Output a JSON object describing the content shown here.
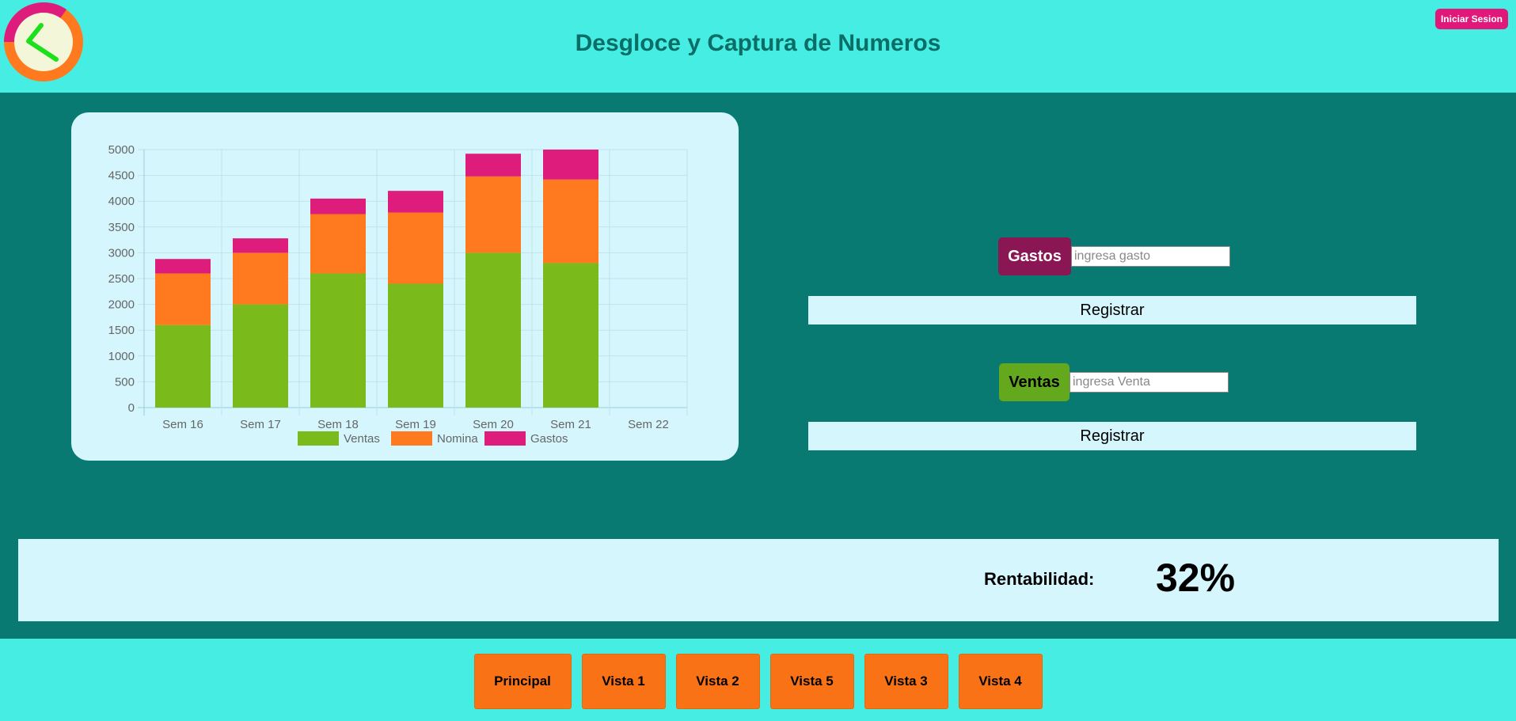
{
  "header": {
    "title": "Desgloce y Captura de Numeros",
    "login_label": "Iniciar Sesion",
    "logo_icon": "clock-logo-icon"
  },
  "colors": {
    "header_bg": "#45ede2",
    "main_bg": "#087a72",
    "card_bg": "#d5f6fd",
    "ventas": "#7aba1a",
    "nomina": "#ff7a1e",
    "gastos": "#de1c7c",
    "nav_button": "#f97316",
    "login_button": "#e0187a"
  },
  "chart_data": {
    "type": "bar",
    "stacked": true,
    "categories": [
      "Sem 16",
      "Sem 17",
      "Sem 18",
      "Sem 19",
      "Sem 20",
      "Sem 21",
      "Sem 22"
    ],
    "series": [
      {
        "name": "Ventas",
        "color": "#7aba1a",
        "values": [
          1600,
          2000,
          2600,
          2400,
          3000,
          2800,
          0
        ]
      },
      {
        "name": "Nomina",
        "color": "#ff7a1e",
        "values": [
          1000,
          1000,
          1150,
          1380,
          1480,
          1620,
          0
        ]
      },
      {
        "name": "Gastos",
        "color": "#de1c7c",
        "values": [
          280,
          280,
          300,
          420,
          440,
          580,
          0
        ]
      }
    ],
    "yticks": [
      "0",
      "500",
      "1000",
      "1500",
      "2000",
      "2500",
      "3000",
      "3500",
      "4000",
      "4500",
      "5000"
    ],
    "ylim": [
      0,
      5000
    ],
    "grid": true,
    "legend_position": "bottom"
  },
  "form": {
    "gastos": {
      "label": "Gastos",
      "placeholder": "ingresa gasto",
      "button": "Registrar"
    },
    "ventas": {
      "label": "Ventas",
      "placeholder": "ingresa Venta",
      "button": "Registrar"
    }
  },
  "rentabilidad": {
    "label": "Rentabilidad:",
    "value": "32%"
  },
  "nav": {
    "items": [
      {
        "label": "Principal"
      },
      {
        "label": "Vista 1"
      },
      {
        "label": "Vista 2"
      },
      {
        "label": "Vista 5"
      },
      {
        "label": "Vista 3"
      },
      {
        "label": "Vista 4"
      }
    ]
  }
}
